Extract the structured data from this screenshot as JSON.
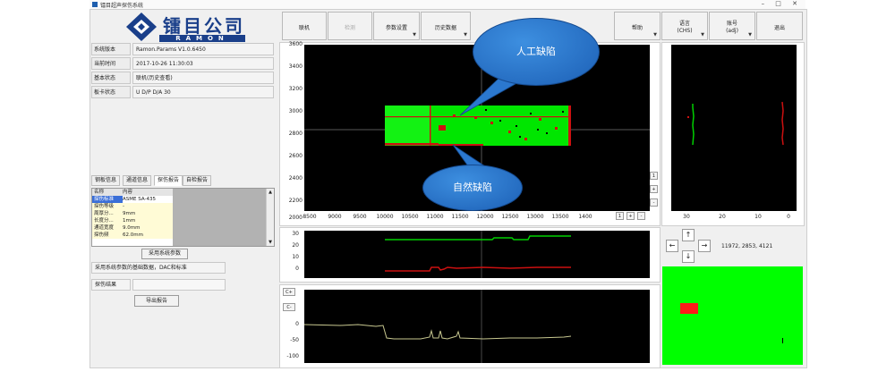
{
  "window": {
    "title": "镭目超声探伤系统",
    "controls": "– □ ✕"
  },
  "logo": {
    "cn": "镭目公司",
    "en": "RAMON"
  },
  "info": [
    {
      "key": "系统版本",
      "value": "Ramon.Params V1.0.6450"
    },
    {
      "key": "当前时间",
      "value": "2017-10-26 11:30:03"
    },
    {
      "key": "基本状态",
      "value": "联机(历史查看)"
    },
    {
      "key": "板卡状态",
      "value": "U  D/P  D/A 30"
    }
  ],
  "tabs": [
    "钢板信息",
    "通道信息",
    "探伤报告",
    "自检报告"
  ],
  "grid": {
    "headers": [
      "名称",
      "内容"
    ],
    "rows": [
      [
        "探伤标准",
        "ASME SA-435"
      ],
      [
        "探伤等级",
        "-"
      ],
      [
        "周厚分...",
        "9mm"
      ],
      [
        "长度分...",
        "1mm"
      ],
      [
        "通道宽度",
        "9.0mm"
      ],
      [
        "探伤频",
        "62.0mm"
      ]
    ]
  },
  "buttons": {
    "use_system_params": "采用系统参数",
    "export_report": "导出报告"
  },
  "note_text": "采用系统参数的基础数据，DAC和标准",
  "result_label": "探伤结果",
  "toolbar": {
    "online": "联机",
    "inspect": "检测",
    "params": "参数设置",
    "history": "历史数据",
    "help": "帮助",
    "language": "语言",
    "language_sub": "(CHS)",
    "account": "账号",
    "account_sub": "(adj)",
    "exit": "退出"
  },
  "main_plot": {
    "y_ticks": [
      "3600",
      "3400",
      "3200",
      "3000",
      "2800",
      "2600",
      "2400",
      "2200",
      "2000"
    ],
    "x_ticks": [
      "8500",
      "9000",
      "9500",
      "10000",
      "10500",
      "11000",
      "11500",
      "12000",
      "12500",
      "13000",
      "13500",
      "1400"
    ]
  },
  "side_plot": {
    "x_ticks": [
      "30",
      "20",
      "10",
      "0"
    ]
  },
  "mid_plot": {
    "y_ticks": [
      "30",
      "20",
      "10",
      "0"
    ]
  },
  "bottom_plot": {
    "y_ticks": [
      "0",
      "-50",
      "-100"
    ]
  },
  "zoom": {
    "plus": "+",
    "minus": "-",
    "one": "1",
    "c_plus": "C+",
    "c_minus": "C-"
  },
  "coordinates": "11972, 2853, 4121",
  "annotations": {
    "artificial_defect": "人工缺陷",
    "natural_defect": "自然缺陷"
  },
  "colors": {
    "green": "#00ff00",
    "red": "#ff1a1a",
    "callout": "#2b78cf",
    "logo_blue": "#1a3f8a"
  }
}
